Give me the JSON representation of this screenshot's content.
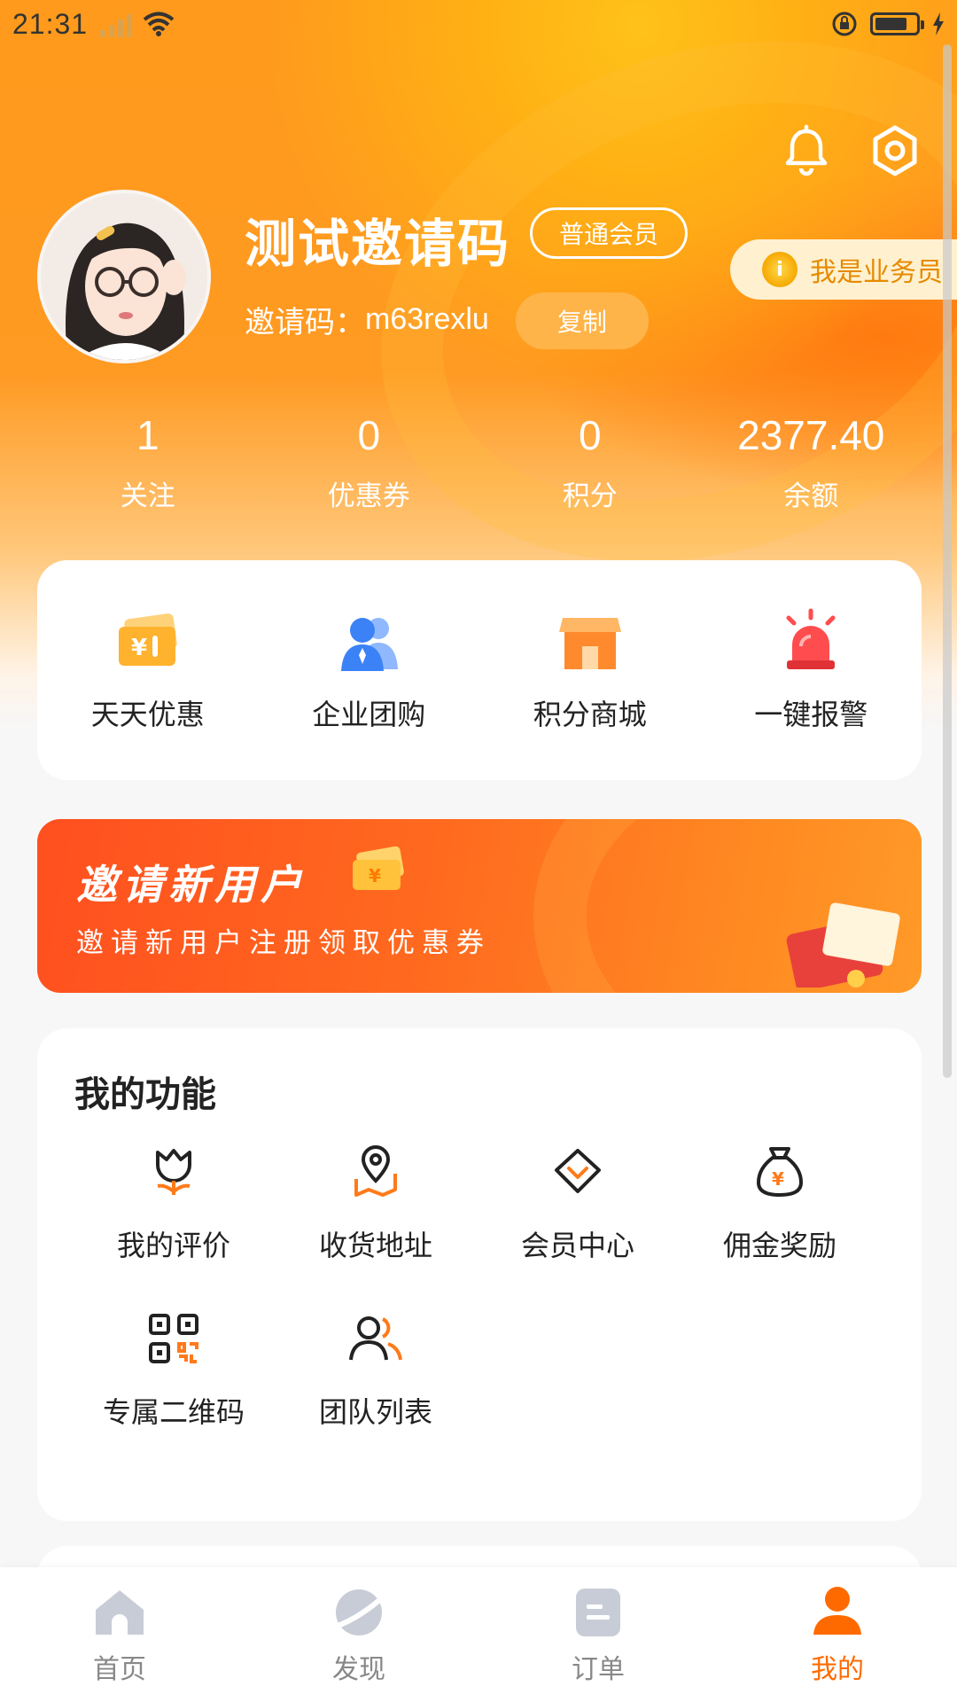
{
  "status_bar": {
    "time": "21:31"
  },
  "profile": {
    "name": "测试邀请码",
    "member_badge": "普通会员",
    "invite_label": "邀请码：",
    "invite_code": "m63rexlu",
    "copy_label": "复制",
    "sales_label": "我是业务员"
  },
  "stats": [
    {
      "value": "1",
      "label": "关注"
    },
    {
      "value": "0",
      "label": "优惠券"
    },
    {
      "value": "0",
      "label": "积分"
    },
    {
      "value": "2377.40",
      "label": "余额"
    }
  ],
  "quick_actions": [
    {
      "label": "天天优惠",
      "icon": "coupon-ticket-icon"
    },
    {
      "label": "企业团购",
      "icon": "group-people-icon"
    },
    {
      "label": "积分商城",
      "icon": "store-icon"
    },
    {
      "label": "一键报警",
      "icon": "alarm-light-icon"
    }
  ],
  "banner": {
    "title": "邀请新用户",
    "subtitle": "邀请新用户注册领取优惠券"
  },
  "functions": {
    "title": "我的功能",
    "items": [
      {
        "label": "我的评价",
        "icon": "flower-icon"
      },
      {
        "label": "收货地址",
        "icon": "location-map-icon"
      },
      {
        "label": "会员中心",
        "icon": "diamond-icon"
      },
      {
        "label": "佣金奖励",
        "icon": "money-bag-icon"
      },
      {
        "label": "专属二维码",
        "icon": "qr-code-icon"
      },
      {
        "label": "团队列表",
        "icon": "team-icon"
      }
    ]
  },
  "tabbar": {
    "active": "我的",
    "tabs": [
      {
        "label": "首页",
        "icon": "home-icon"
      },
      {
        "label": "发现",
        "icon": "planet-icon"
      },
      {
        "label": "订单",
        "icon": "order-icon"
      },
      {
        "label": "我的",
        "icon": "user-icon"
      }
    ]
  },
  "colors": {
    "accent": "#ff6a00",
    "hero": "#ff9a1c",
    "icon_orange": "#ff7a1a",
    "tab_inactive": "#c8ccd6"
  }
}
